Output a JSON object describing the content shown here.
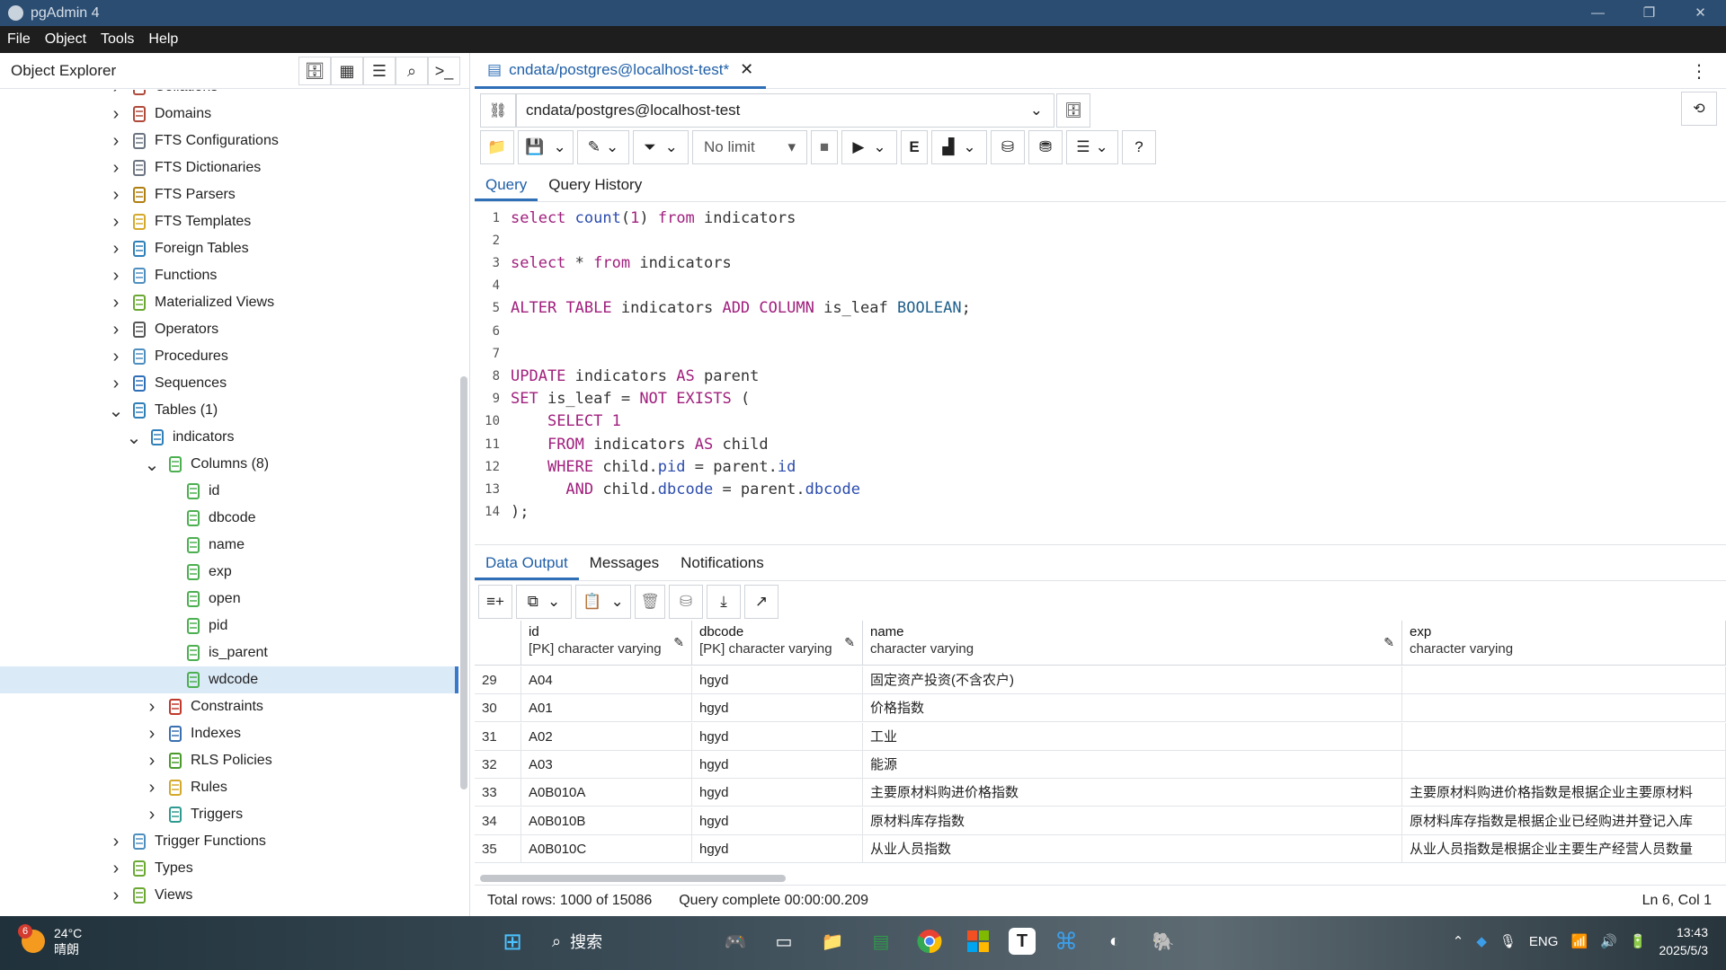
{
  "window": {
    "title": "pgAdmin 4",
    "controls": [
      "—",
      "❐",
      "✕"
    ]
  },
  "menu": [
    "File",
    "Object",
    "Tools",
    "Help"
  ],
  "explorer": {
    "title": "Object Explorer",
    "tree": [
      {
        "label": "Collations",
        "depth": 0,
        "expanded": false,
        "icon": "collation-icon",
        "color": "#b04a3a"
      },
      {
        "label": "Domains",
        "depth": 0,
        "expanded": false,
        "icon": "domain-icon",
        "color": "#b04a3a"
      },
      {
        "label": "FTS Configurations",
        "depth": 0,
        "expanded": false,
        "icon": "fts-configuration-icon",
        "color": "#6b7480"
      },
      {
        "label": "FTS Dictionaries",
        "depth": 0,
        "expanded": false,
        "icon": "fts-dictionary-icon",
        "color": "#6b7480"
      },
      {
        "label": "FTS Parsers",
        "depth": 0,
        "expanded": false,
        "icon": "fts-parser-icon",
        "color": "#b07f10"
      },
      {
        "label": "FTS Templates",
        "depth": 0,
        "expanded": false,
        "icon": "fts-template-icon",
        "color": "#d4a82a"
      },
      {
        "label": "Foreign Tables",
        "depth": 0,
        "expanded": false,
        "icon": "foreign-table-icon",
        "color": "#2f7fb8"
      },
      {
        "label": "Functions",
        "depth": 0,
        "expanded": false,
        "icon": "function-icon",
        "color": "#4f8fc0"
      },
      {
        "label": "Materialized Views",
        "depth": 0,
        "expanded": false,
        "icon": "materialized-view-icon",
        "color": "#6aa832"
      },
      {
        "label": "Operators",
        "depth": 0,
        "expanded": false,
        "icon": "operator-icon",
        "color": "#555"
      },
      {
        "label": "Procedures",
        "depth": 0,
        "expanded": false,
        "icon": "procedure-icon",
        "color": "#4f8fc0"
      },
      {
        "label": "Sequences",
        "depth": 0,
        "expanded": false,
        "icon": "sequence-icon",
        "color": "#2f6fb8"
      },
      {
        "label": "Tables (1)",
        "depth": 0,
        "expanded": true,
        "icon": "table-icon",
        "color": "#2f7fb8"
      },
      {
        "label": "indicators",
        "depth": 1,
        "expanded": true,
        "icon": "table-icon",
        "color": "#2f7fb8"
      },
      {
        "label": "Columns (8)",
        "depth": 2,
        "expanded": true,
        "icon": "columns-icon",
        "color": "#4caf50"
      },
      {
        "label": "id",
        "depth": 3,
        "leaf": true,
        "icon": "column-icon",
        "color": "#4caf50"
      },
      {
        "label": "dbcode",
        "depth": 3,
        "leaf": true,
        "icon": "column-icon",
        "color": "#4caf50"
      },
      {
        "label": "name",
        "depth": 3,
        "leaf": true,
        "icon": "column-icon",
        "color": "#4caf50"
      },
      {
        "label": "exp",
        "depth": 3,
        "leaf": true,
        "icon": "column-icon",
        "color": "#4caf50"
      },
      {
        "label": "open",
        "depth": 3,
        "leaf": true,
        "icon": "column-icon",
        "color": "#4caf50"
      },
      {
        "label": "pid",
        "depth": 3,
        "leaf": true,
        "icon": "column-icon",
        "color": "#4caf50"
      },
      {
        "label": "is_parent",
        "depth": 3,
        "leaf": true,
        "icon": "column-icon",
        "color": "#4caf50"
      },
      {
        "label": "wdcode",
        "depth": 3,
        "leaf": true,
        "selected": true,
        "icon": "column-icon",
        "color": "#4caf50"
      },
      {
        "label": "Constraints",
        "depth": 2,
        "expanded": false,
        "icon": "constraint-icon",
        "color": "#c0392b"
      },
      {
        "label": "Indexes",
        "depth": 2,
        "expanded": false,
        "icon": "index-icon",
        "color": "#3a6fb0"
      },
      {
        "label": "RLS Policies",
        "depth": 2,
        "expanded": false,
        "icon": "rls-policy-icon",
        "color": "#4a9a2a"
      },
      {
        "label": "Rules",
        "depth": 2,
        "expanded": false,
        "icon": "rule-icon",
        "color": "#d4a82a"
      },
      {
        "label": "Triggers",
        "depth": 2,
        "expanded": false,
        "icon": "trigger-icon",
        "color": "#2f9a8f"
      },
      {
        "label": "Trigger Functions",
        "depth": 0,
        "expanded": false,
        "icon": "trigger-function-icon",
        "color": "#4f8fc0"
      },
      {
        "label": "Types",
        "depth": 0,
        "expanded": false,
        "icon": "type-icon",
        "color": "#6aa832"
      },
      {
        "label": "Views",
        "depth": 0,
        "expanded": false,
        "icon": "view-icon",
        "color": "#6aa832"
      }
    ]
  },
  "query_tab": {
    "label": "cndata/postgres@localhost-test*"
  },
  "connection": {
    "value": "cndata/postgres@localhost-test"
  },
  "toolbar": {
    "limit": "No limit"
  },
  "editor_tabs": [
    "Query",
    "Query History"
  ],
  "editor": {
    "lines": [
      "select count(1) from indicators",
      "",
      "select * from indicators",
      "",
      "ALTER TABLE indicators ADD COLUMN is_leaf BOOLEAN;",
      "",
      "",
      "UPDATE indicators AS parent",
      "SET is_leaf = NOT EXISTS (",
      "    SELECT 1",
      "    FROM indicators AS child",
      "    WHERE child.pid = parent.id",
      "      AND child.dbcode = parent.dbcode",
      ");"
    ]
  },
  "result_tabs": [
    "Data Output",
    "Messages",
    "Notifications"
  ],
  "grid": {
    "columns": [
      {
        "name": "id",
        "type": "[PK] character varying"
      },
      {
        "name": "dbcode",
        "type": "[PK] character varying"
      },
      {
        "name": "name",
        "type": "character varying"
      },
      {
        "name": "exp",
        "type": "character varying"
      }
    ],
    "rows": [
      {
        "n": "29",
        "id": "A04",
        "dbcode": "hgyd",
        "name": "固定资产投资(不含农户)",
        "exp": ""
      },
      {
        "n": "30",
        "id": "A01",
        "dbcode": "hgyd",
        "name": "价格指数",
        "exp": ""
      },
      {
        "n": "31",
        "id": "A02",
        "dbcode": "hgyd",
        "name": "工业",
        "exp": ""
      },
      {
        "n": "32",
        "id": "A03",
        "dbcode": "hgyd",
        "name": "能源",
        "exp": ""
      },
      {
        "n": "33",
        "id": "A0B010A",
        "dbcode": "hgyd",
        "name": "主要原材料购进价格指数",
        "exp": "主要原材料购进价格指数是根据企业主要原材料"
      },
      {
        "n": "34",
        "id": "A0B010B",
        "dbcode": "hgyd",
        "name": "原材料库存指数",
        "exp": "原材料库存指数是根据企业已经购进并登记入库"
      },
      {
        "n": "35",
        "id": "A0B010C",
        "dbcode": "hgyd",
        "name": "从业人员指数",
        "exp": "从业人员指数是根据企业主要生产经营人员数量"
      }
    ]
  },
  "status": {
    "total": "Total rows: 1000 of 15086",
    "complete": "Query complete 00:00:00.209",
    "position": "Ln 6, Col 1"
  },
  "taskbar": {
    "weather_temp": "24°C",
    "weather_desc": "晴朗",
    "weather_badge": "6",
    "search": "搜索",
    "lang": "ENG",
    "time": "13:43",
    "date": "2025/5/3"
  }
}
